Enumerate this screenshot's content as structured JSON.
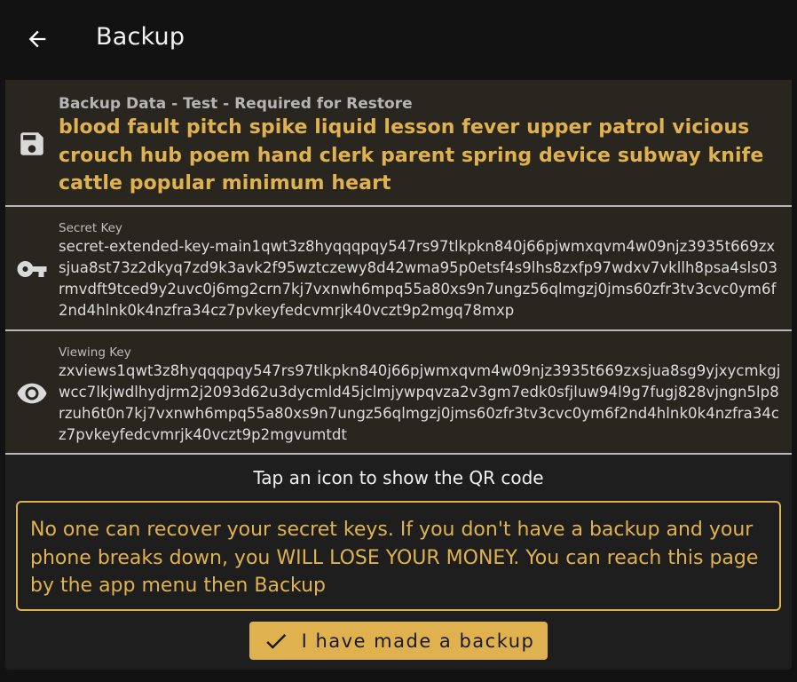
{
  "header": {
    "title": "Backup",
    "back_icon": "arrow-left-icon"
  },
  "seed": {
    "icon": "floppy-disk-icon",
    "label": "Backup Data - Test - Required for Restore",
    "words": "blood fault pitch spike liquid lesson fever upper patrol vicious crouch hub poem hand clerk parent spring device subway knife cattle popular minimum heart"
  },
  "secret_key": {
    "icon": "key-icon",
    "label": "Secret Key",
    "value": "secret-extended-key-main1qwt3z8hyqqqpqy547rs97tlkpkn840j66pjwmxqvm4w09njz3935t669zxsjua8st73z2dkyq7zd9k3avk2f95wztczewy8d42wma95p0etsf4s9lhs8zxfp97wdxv7vkllh8psa4sls03rmvdft9tced9y2uvc0j6mg2crn7kj7vxnwh6mpq55a80xs9n7ungz56qlmgzj0jms60zfr3tv3cvc0ym6f2nd4hlnk0k4nzfra34cz7pvkeyfedcvmrjk40vczt9p2mgq78mxp"
  },
  "viewing_key": {
    "icon": "eye-icon",
    "label": "Viewing Key",
    "value": "zxviews1qwt3z8hyqqqpqy547rs97tlkpkn840j66pjwmxqvm4w09njz3935t669zxsjua8sg9yjxycmkgjwcc7lkjwdlhydjrm2j2093d62u3dycmld45jclmjywpqvza2v3gm7edk0sfjluw94l9g7fugj828vjngn5lp8rzuh6t0n7kj7vxnwh6mpq55a80xs9n7ungz56qlmgzj0jms60zfr3tv3cvc0ym6f2nd4hlnk0k4nzfra34cz7pvkeyfedcvmrjk40vczt9p2mgvumtdt"
  },
  "hint": "Tap an icon to show the QR code",
  "warning": "No one can recover your secret keys. If you don't have a backup and your phone breaks down, you WILL LOSE YOUR MONEY. You can reach this page by the app menu then Backup",
  "confirm": {
    "icon": "check-icon",
    "label": "I have made a backup"
  },
  "colors": {
    "accent": "#e0b24f",
    "background": "#121212",
    "section": "#29261f"
  }
}
